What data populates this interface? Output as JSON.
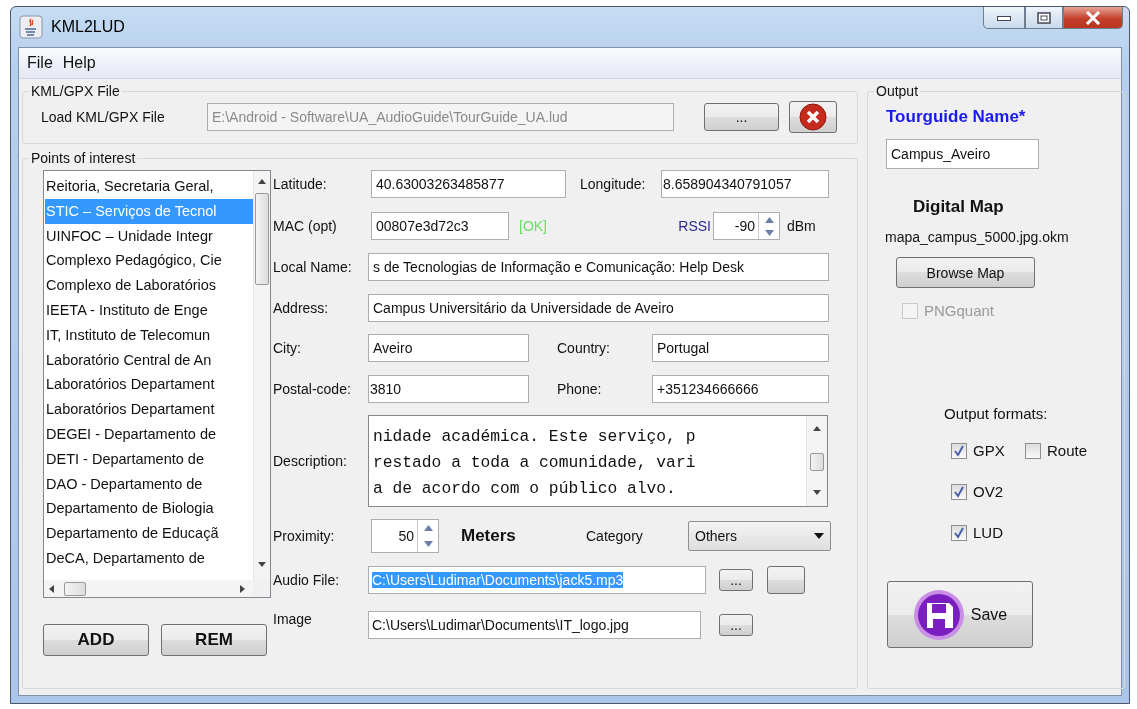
{
  "window": {
    "title": "KML2LUD"
  },
  "menu": [
    "File",
    "Help"
  ],
  "kml_file": {
    "legend": "KML/GPX File",
    "label": "Load KML/GPX File",
    "path": "E:\\Android - Software\\UA_AudioGuide\\TourGuide_UA.lud",
    "path_disabled": true,
    "browse_button": "..."
  },
  "points_of_interest": {
    "legend": "Points of interest",
    "items": [
      {
        "label": "Reitoria, Secretaria Geral,",
        "selected": false
      },
      {
        "label": "STIC – Serviços de Tecnol",
        "selected": true
      },
      {
        "label": "UINFOC – Unidade Integr",
        "selected": false
      },
      {
        "label": "Complexo Pedagógico, Cie",
        "selected": false
      },
      {
        "label": "Complexo de Laboratórios",
        "selected": false
      },
      {
        "label": "IEETA - Instituto de Enge",
        "selected": false
      },
      {
        "label": "IT, Instituto de Telecomun",
        "selected": false
      },
      {
        "label": "Laboratório Central de An",
        "selected": false
      },
      {
        "label": "Laboratórios Departament",
        "selected": false
      },
      {
        "label": "Laboratórios Departament",
        "selected": false
      },
      {
        "label": "DEGEI - Departamento de",
        "selected": false
      },
      {
        "label": "DETI - Departamento de",
        "selected": false
      },
      {
        "label": "DAO - Departamento de",
        "selected": false
      },
      {
        "label": "Departamento de Biologia",
        "selected": false
      },
      {
        "label": "Departamento de Educaçã",
        "selected": false
      },
      {
        "label": "DeCA, Departamento de",
        "selected": false
      }
    ],
    "add_button": "ADD",
    "remove_button": "REM"
  },
  "form": {
    "latitude": {
      "label": "Latitude:",
      "value": "40.63003263485877"
    },
    "longitude": {
      "label": "Longitude:",
      "value": "8.658904340791057"
    },
    "mac": {
      "label": "MAC (opt)",
      "value": "00807e3d72c3",
      "status": "[OK]"
    },
    "rssi": {
      "label": "RSSI",
      "value": "-90",
      "unit": "dBm"
    },
    "local_name": {
      "label": "Local Name:",
      "value": "s de Tecnologias de Informação e Comunicação: Help Desk"
    },
    "address": {
      "label": "Address:",
      "value": "Campus Universitário da Universidade de Aveiro"
    },
    "city": {
      "label": "City:",
      "value": "Aveiro"
    },
    "country": {
      "label": "Country:",
      "value": "Portugal"
    },
    "postal_code": {
      "label": "Postal-code:",
      "value": "3810"
    },
    "phone": {
      "label": "Phone:",
      "value": "+351234666666"
    },
    "description": {
      "label": "Description:",
      "lines": [
        "nidade académica. Este serviço, p",
        "restado a toda a comunidade, vari",
        "a de acordo com o público alvo."
      ]
    },
    "proximity": {
      "label": "Proximity:",
      "value": "50",
      "unit": "Meters"
    },
    "category": {
      "label": "Category",
      "value": "Others"
    },
    "audio_file": {
      "label": "Audio File:",
      "value": "C:\\Users\\Ludimar\\Documents\\jack5.mp3",
      "text_selected": true,
      "browse_button": "..."
    },
    "image": {
      "label": "Image",
      "value": "C:\\Users\\Ludimar\\Documents\\IT_logo.jpg",
      "text_selected": false,
      "browse_button": "..."
    }
  },
  "output": {
    "legend": "Output",
    "tourguide_label": "Tourguide Name*",
    "tourguide_name": "Campus_Aveiro",
    "map_title": "Digital Map",
    "map_file": "mapa_campus_5000.jpg.okm",
    "browse_map_button": "Browse Map",
    "pngquant": {
      "label": "PNGquant",
      "checked": false,
      "disabled": true
    },
    "formats_label": "Output formats:",
    "formats": [
      {
        "label": "GPX",
        "checked": true
      },
      {
        "label": "Route",
        "checked": false
      },
      {
        "label": "OV2",
        "checked": true
      },
      {
        "label": "LUD",
        "checked": true
      }
    ],
    "save_button": "Save"
  }
}
